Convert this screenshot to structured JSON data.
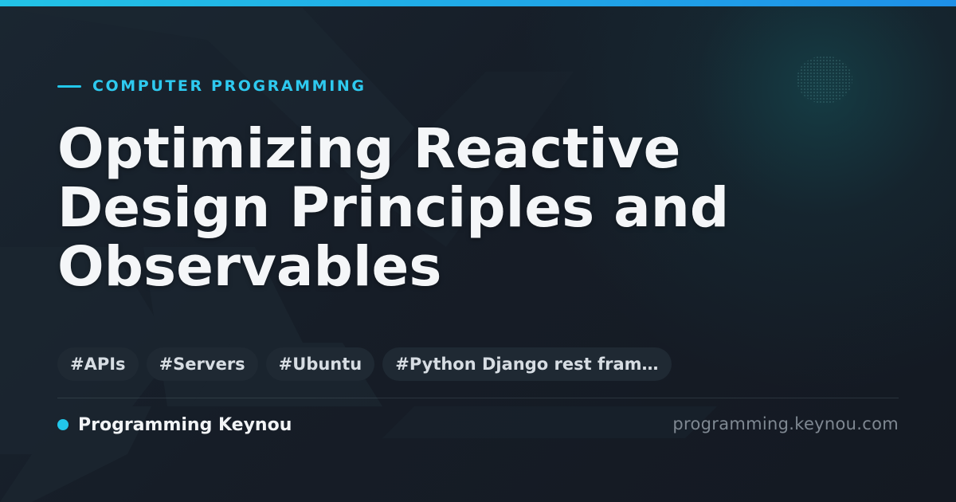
{
  "header": {
    "category": "COMPUTER PROGRAMMING",
    "title_lines": [
      "Optimizing Reactive",
      "Design Principles and",
      "Observables"
    ]
  },
  "tags": [
    "#APIs",
    "#Servers",
    "#Ubuntu",
    "#Python Django rest fram…"
  ],
  "footer": {
    "site_name": "Programming Keynou",
    "domain": "programming.keynou.com"
  },
  "colors": {
    "accent": "#22c7ea",
    "background": "#151b24",
    "title": "#f4f6f8",
    "tag_background": "#1f2933",
    "muted": "#7f8892"
  },
  "icons": [
    "accent-line-icon",
    "site-dot-icon"
  ]
}
